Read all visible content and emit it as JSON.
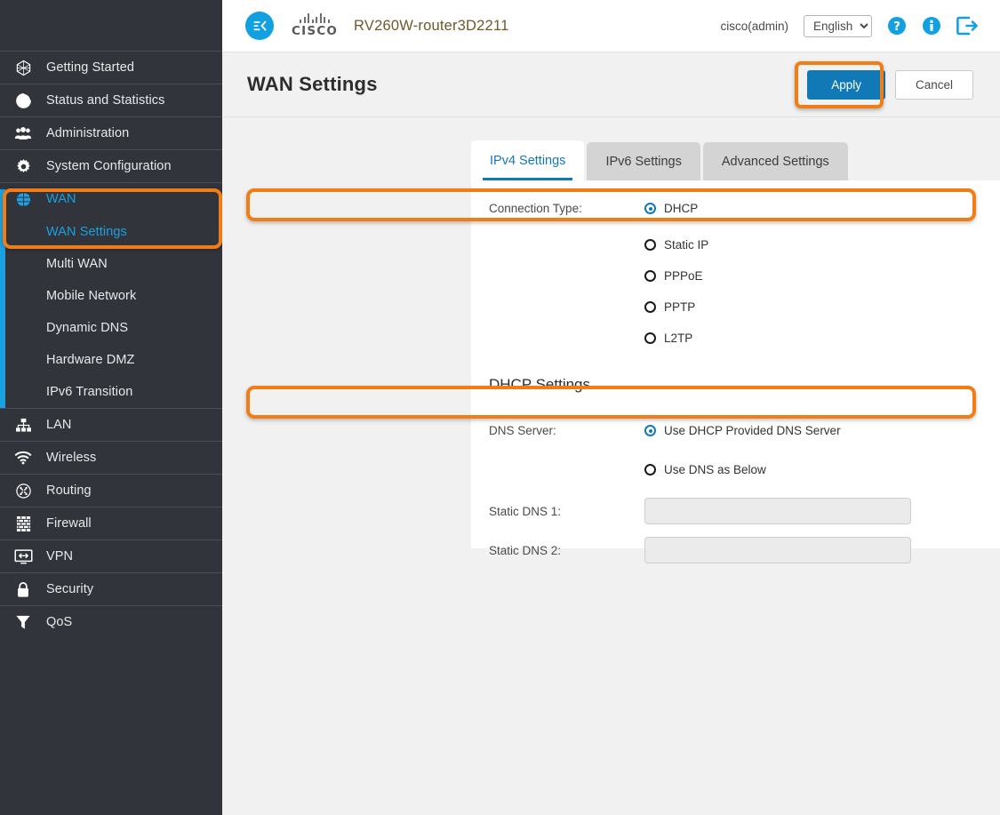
{
  "colors": {
    "sidebar_bg": "#31343b",
    "accent_blue": "#1279b7",
    "link_blue": "#1ba0e1",
    "highlight_orange": "#f07d17",
    "page_bg": "#f1f1f1"
  },
  "header": {
    "collapse_icon": "collapse-menu-icon",
    "brand": "CISCO",
    "device_name": "RV260W-router3D2211",
    "user": "cisco(admin)",
    "language": {
      "selected": "English",
      "options": [
        "English"
      ]
    },
    "icons": [
      {
        "name": "help-icon",
        "glyph": "?"
      },
      {
        "name": "info-icon",
        "glyph": "i"
      },
      {
        "name": "logout-icon",
        "glyph": "logout"
      }
    ]
  },
  "page": {
    "title": "WAN Settings",
    "apply_label": "Apply",
    "cancel_label": "Cancel"
  },
  "sidebar": {
    "items": [
      {
        "label": "Getting Started",
        "icon": "getting-started-icon",
        "type": "primary",
        "active": false
      },
      {
        "label": "Status and Statistics",
        "icon": "status-statistics-icon",
        "type": "primary",
        "active": false
      },
      {
        "label": "Administration",
        "icon": "administration-icon",
        "type": "primary",
        "active": false
      },
      {
        "label": "System Configuration",
        "icon": "system-configuration-icon",
        "type": "primary",
        "active": false
      },
      {
        "label": "WAN",
        "icon": "wan-globe-icon",
        "type": "primary",
        "active": true
      },
      {
        "label": "WAN Settings",
        "icon": "",
        "type": "sub",
        "active": true
      },
      {
        "label": "Multi WAN",
        "icon": "",
        "type": "sub",
        "active": false
      },
      {
        "label": "Mobile Network",
        "icon": "",
        "type": "sub",
        "active": false
      },
      {
        "label": "Dynamic DNS",
        "icon": "",
        "type": "sub",
        "active": false
      },
      {
        "label": "Hardware DMZ",
        "icon": "",
        "type": "sub",
        "active": false
      },
      {
        "label": "IPv6 Transition",
        "icon": "",
        "type": "sub",
        "active": false
      },
      {
        "label": "LAN",
        "icon": "lan-icon",
        "type": "primary",
        "active": false
      },
      {
        "label": "Wireless",
        "icon": "wireless-icon",
        "type": "primary",
        "active": false
      },
      {
        "label": "Routing",
        "icon": "routing-icon",
        "type": "primary",
        "active": false
      },
      {
        "label": "Firewall",
        "icon": "firewall-icon",
        "type": "primary",
        "active": false
      },
      {
        "label": "VPN",
        "icon": "vpn-icon",
        "type": "primary",
        "active": false
      },
      {
        "label": "Security",
        "icon": "security-lock-icon",
        "type": "primary",
        "active": false
      },
      {
        "label": "QoS",
        "icon": "qos-funnel-icon",
        "type": "primary",
        "active": false
      }
    ]
  },
  "tabs": [
    {
      "label": "IPv4 Settings",
      "active": true
    },
    {
      "label": "IPv6 Settings",
      "active": false
    },
    {
      "label": "Advanced Settings",
      "active": false
    }
  ],
  "form": {
    "connection_type": {
      "label": "Connection Type:",
      "options": [
        {
          "label": "DHCP",
          "selected": true
        },
        {
          "label": "Static IP",
          "selected": false
        },
        {
          "label": "PPPoE",
          "selected": false
        },
        {
          "label": "PPTP",
          "selected": false
        },
        {
          "label": "L2TP",
          "selected": false
        }
      ]
    },
    "dhcp_section_title": "DHCP Settings",
    "dns_server": {
      "label": "DNS Server:",
      "options": [
        {
          "label": "Use DHCP Provided DNS Server",
          "selected": true
        },
        {
          "label": "Use DNS as Below",
          "selected": false
        }
      ]
    },
    "static_dns_1": {
      "label": "Static DNS 1:",
      "value": "",
      "placeholder": "",
      "disabled": true
    },
    "static_dns_2": {
      "label": "Static DNS 2:",
      "value": "",
      "placeholder": "",
      "disabled": true
    }
  }
}
